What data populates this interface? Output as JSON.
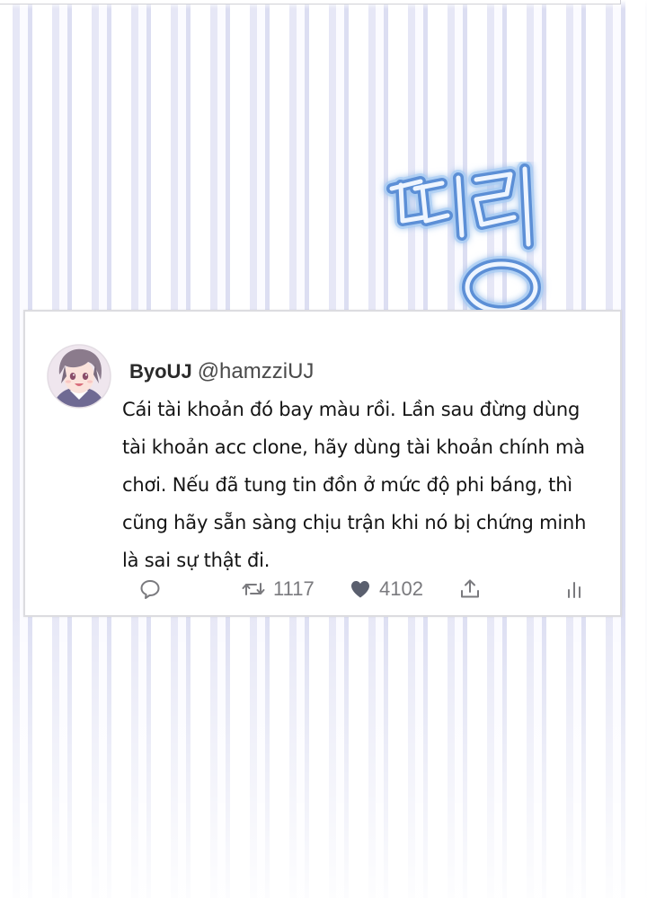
{
  "sfx": {
    "text": "띠링",
    "fill_color": "#dbe9fb",
    "outline_color": "#5b8fd6",
    "glow_color": "#a7cdf5"
  },
  "tweet": {
    "author_name": "ByoUJ",
    "author_handle": "@hamzziUJ",
    "avatar_icon": "avatar-anime-boy",
    "text": "Cái tài khoản đó bay màu rồi. Lần sau đừng dùng tài khoản acc clone, hãy dùng tài khoản chính mà chơi. Nếu đã tung tin đồn ở mức độ phi báng, thì cũng hãy sẵn sàng chịu trận khi nó bị chứng minh là sai sự thật đi.",
    "actions": {
      "reply_icon": "comment-bubble-icon",
      "retweet_icon": "retweet-arrows-icon",
      "retweet_count": "1117",
      "like_icon": "heart-icon",
      "like_count": "4102",
      "share_icon": "share-upload-icon",
      "stats_icon": "bar-chart-icon"
    },
    "icon_color": "#7a7a7e",
    "like_color": "#5a5f6e"
  }
}
